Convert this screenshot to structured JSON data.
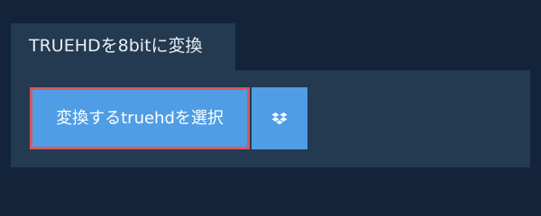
{
  "header": {
    "title": "TRUEHDを8bitに変換"
  },
  "actions": {
    "select_label": "変換するtruehdを選択",
    "dropbox_icon": "dropbox-icon"
  },
  "colors": {
    "page_background": "#13243a",
    "panel_background": "#233a51",
    "button_blue": "#4f9ee5",
    "focus_outline": "#d6595f",
    "text_light": "#e9eff6"
  }
}
